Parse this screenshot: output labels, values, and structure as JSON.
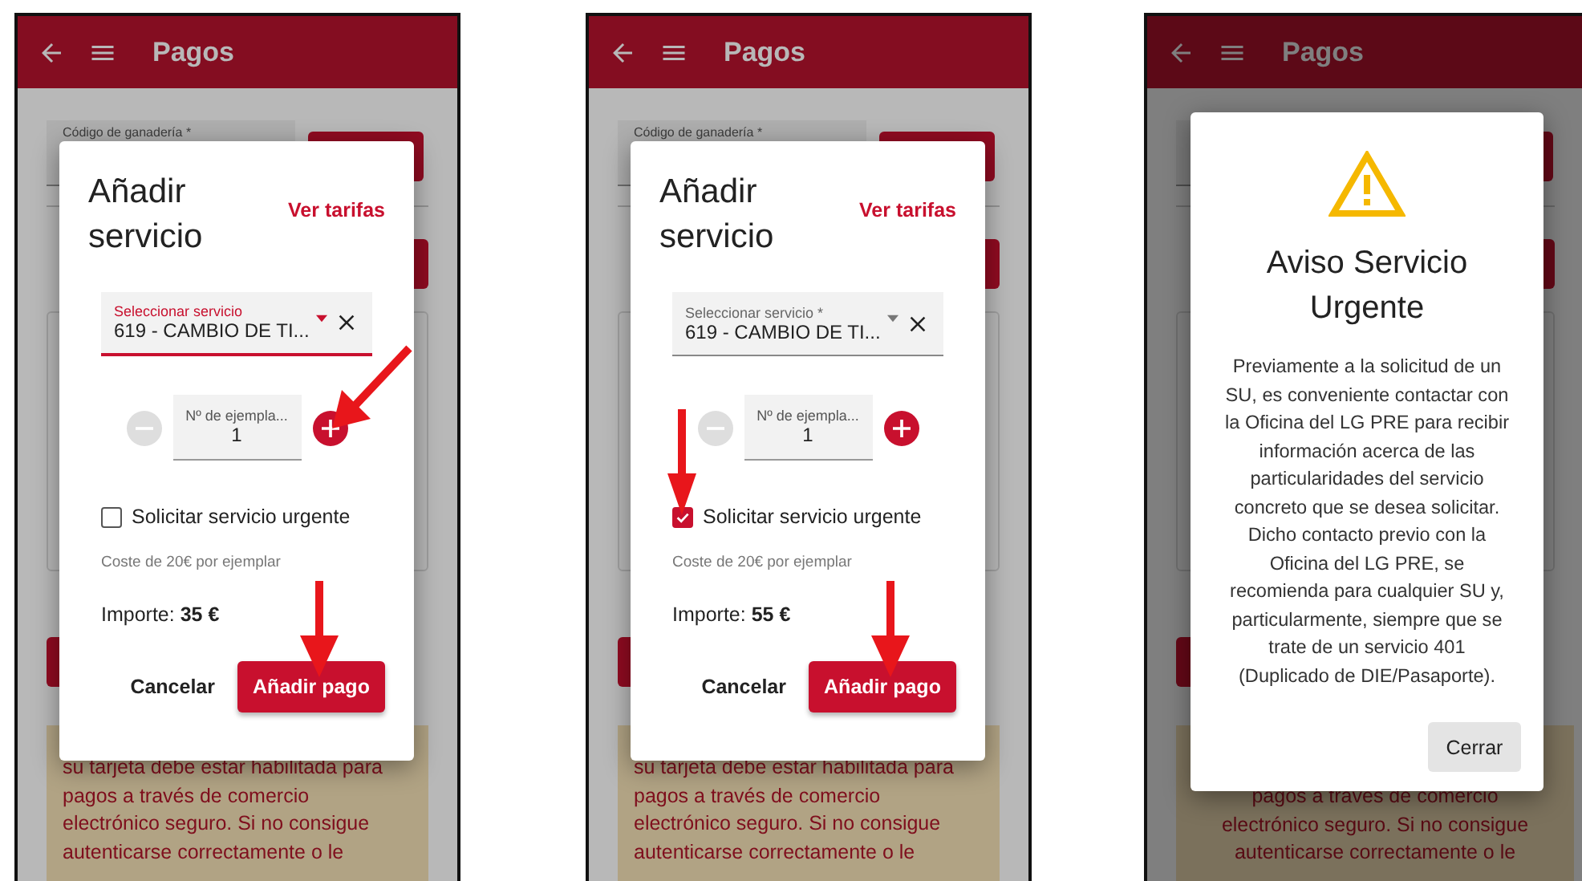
{
  "phones": [
    {
      "header": {
        "title": "Pagos"
      },
      "background": {
        "field_label": "Código de ganadería *",
        "warning_lines": [
          "su tarjeta debe estar habilitada para",
          "pagos a través de comercio",
          "electrónico seguro. Si no consigue",
          "autenticarse correctamente o le"
        ]
      },
      "dialog": {
        "kind": "add_service",
        "title": "Añadir servicio",
        "link": "Ver tarifas",
        "select": {
          "label": "Seleccionar servicio",
          "value": "619 - CAMBIO DE TI...",
          "focused": true
        },
        "quantity": {
          "label": "Nº de ejempla...",
          "value": "1"
        },
        "urgent": {
          "label": "Solicitar servicio urgente",
          "checked": false
        },
        "hint": "Coste de 20€ por ejemplar",
        "amount": "Importe: **35 €**",
        "buttons": [
          "Cancelar",
          "Añadir pago"
        ]
      },
      "arrows": [
        {
          "kind": "plus"
        },
        {
          "kind": "submit"
        }
      ]
    },
    {
      "header": {
        "title": "Pagos"
      },
      "background": {
        "field_label": "Código de ganadería *",
        "warning_lines": [
          "su tarjeta debe estar habilitada para",
          "pagos a través de comercio",
          "electrónico seguro. Si no consigue",
          "autenticarse correctamente o le"
        ]
      },
      "dialog": {
        "kind": "add_service",
        "title": "Añadir servicio",
        "link": "Ver tarifas",
        "select": {
          "label": "Seleccionar servicio *",
          "value": "619 - CAMBIO DE TI...",
          "focused": false
        },
        "quantity": {
          "label": "Nº de ejempla...",
          "value": "1"
        },
        "urgent": {
          "label": "Solicitar servicio urgente",
          "checked": true
        },
        "hint": "Coste de 20€ por ejemplar",
        "amount": "Importe: **55 €**",
        "buttons": [
          "Cancelar",
          "Añadir pago"
        ]
      },
      "arrows": [
        {
          "kind": "checkbox"
        },
        {
          "kind": "submit"
        }
      ]
    },
    {
      "header": {
        "title": "Pagos"
      },
      "background": {
        "warning_lines": [
          "pagos a través de comercio",
          "electrónico seguro. Si no consigue",
          "autenticarse correctamente o le"
        ]
      },
      "dialog": {
        "kind": "alert",
        "title": "Aviso Servicio Urgente",
        "body": "Previamente a la solicitud de un SU, es conveniente contactar con la Oficina del LG PRE para recibir información acerca de las particularidades del servicio concreto que se desea solicitar. Dicho contacto previo con la Oficina del LG PRE, se recomienda para cualquier SU y, particularmente, siempre que se trate de un servicio 401 (Duplicado de DIE/Pasaporte).",
        "buttons": [
          "Cerrar"
        ]
      }
    }
  ]
}
